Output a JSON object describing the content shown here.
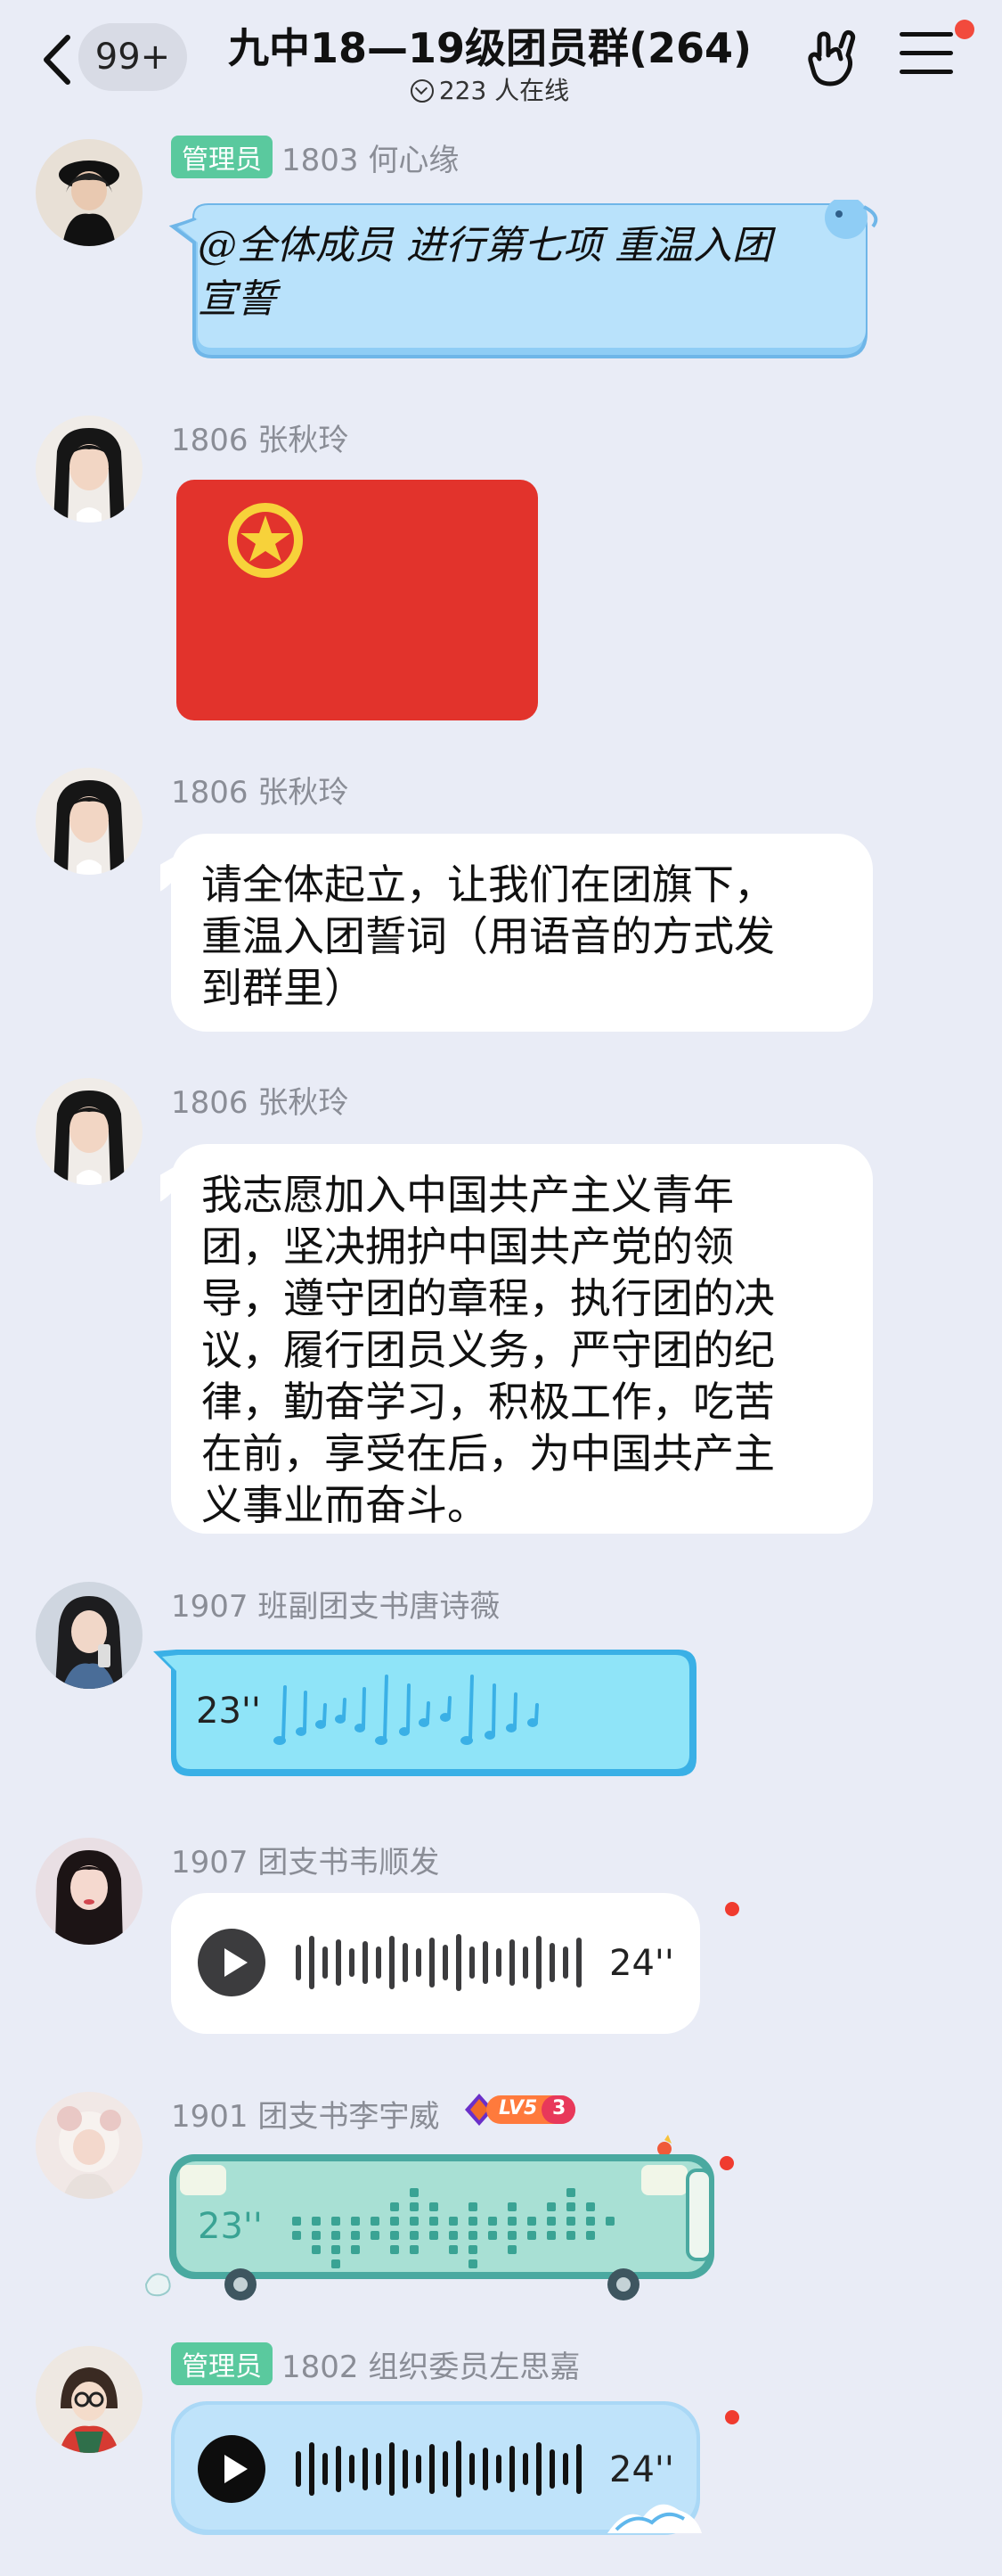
{
  "header": {
    "unread_count": "99+",
    "title": "九中18—19级团员群(264)",
    "online": "223 人在线"
  },
  "messages": [
    {
      "admin": "管理员",
      "name": "1803 何心缘",
      "text_line1": "@全体成员 进行第七项 重温入团",
      "text_line2": "宣誓"
    },
    {
      "name": "1806  张秋玲"
    },
    {
      "name": "1806  张秋玲",
      "lines": [
        "请全体起立，让我们在团旗下，",
        "重温入团誓词（用语音的方式发",
        "到群里）"
      ]
    },
    {
      "name": "1806  张秋玲",
      "lines": [
        "我志愿加入中国共产主义青年",
        "团，坚决拥护中国共产党的领",
        "导，遵守团的章程，执行团的决",
        "议，履行团员义务，严守团的纪",
        "律，勤奋学习，积极工作，吃苦",
        "在前，享受在后，为中国共产主",
        "义事业而奋斗。"
      ]
    },
    {
      "name": "1907 班副团支书唐诗薇",
      "duration": "23''"
    },
    {
      "name": "1907 团支书韦顺发",
      "duration": "24''"
    },
    {
      "name": "1901 团支书李宇威",
      "level": "LV5",
      "level_num": "3",
      "duration": "23''"
    },
    {
      "admin": "管理员",
      "name": "1802 组织委员左思嘉",
      "duration": "24''"
    }
  ],
  "colors": {
    "background": "#e9ecf6",
    "admin_tag": "#5ac99e",
    "flag_red": "#e2332c",
    "unread_dot": "#f03b2f"
  }
}
